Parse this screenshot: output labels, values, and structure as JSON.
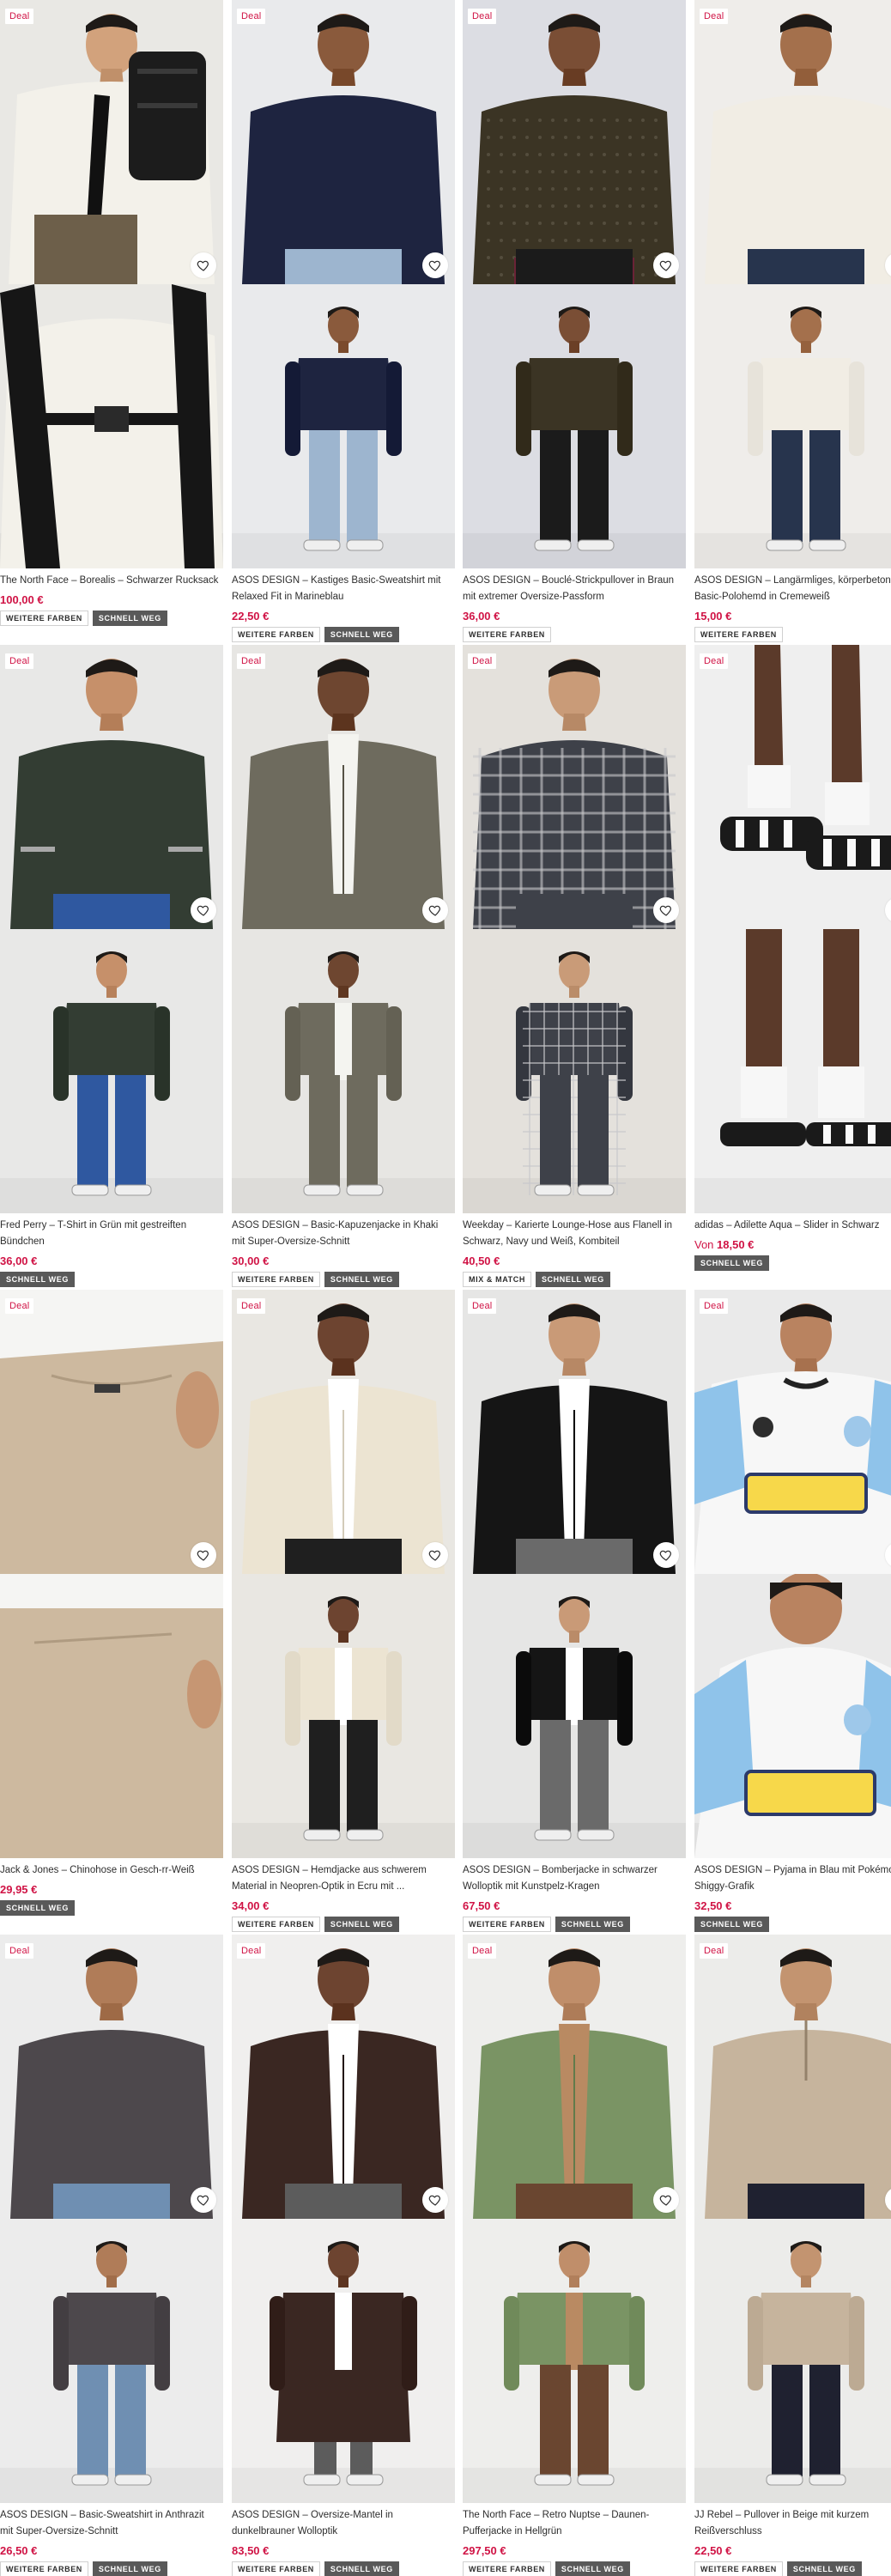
{
  "deal_label": "Deal",
  "products": [
    {
      "title": "The North Face – Borealis – Schwarzer Rucksack",
      "price": "100,00 €",
      "price_prefix": "",
      "deal": true,
      "tags": [
        "WEITERE FARBEN",
        "SCHNELL WEG"
      ],
      "garment": "backpack",
      "colors": {
        "bg": "#e9e8e4",
        "top": "#f3f1ea",
        "bottom": "#6d5f4a",
        "accent": "#1c1c1c",
        "skin": "#d2a27c"
      }
    },
    {
      "title": "ASOS DESIGN – Kastiges Basic-Sweatshirt mit Relaxed Fit in Marineblau",
      "price": "22,50 €",
      "price_prefix": "",
      "deal": true,
      "tags": [
        "WEITERE FARBEN",
        "SCHNELL WEG"
      ],
      "garment": "sweatshirt",
      "colors": {
        "bg": "#e9eaec",
        "top": "#1e2440",
        "bottom": "#9db5cf",
        "accent": "#1e2440",
        "skin": "#8a5a3c"
      }
    },
    {
      "title": "ASOS DESIGN – Bouclé-Strickpullover in Braun mit extremer Oversize-Passform",
      "price": "36,00 €",
      "price_prefix": "",
      "deal": true,
      "tags": [
        "WEITERE FARBEN"
      ],
      "garment": "knit",
      "colors": {
        "bg": "#dcdde3",
        "top": "#3b3424",
        "bottom": "#1b1b1b",
        "accent": "#6b2336",
        "skin": "#7a4e35"
      }
    },
    {
      "title": "ASOS DESIGN – Langärmliges, körperbetontes Basic-Polohemd in Cremeweiß",
      "price": "15,00 €",
      "price_prefix": "",
      "deal": true,
      "tags": [
        "WEITERE FARBEN"
      ],
      "garment": "polo",
      "colors": {
        "bg": "#efedea",
        "top": "#f1ede4",
        "bottom": "#27344d",
        "accent": "#27344d",
        "skin": "#a4704c"
      }
    },
    {
      "title": "Fred Perry – T-Shirt in Grün mit gestreiften Bündchen",
      "price": "36,00 €",
      "price_prefix": "",
      "deal": true,
      "tags": [
        "SCHNELL WEG"
      ],
      "garment": "tshirt",
      "colors": {
        "bg": "#e8e8e7",
        "top": "#333d33",
        "bottom": "#2f58a0",
        "accent": "#a8a8a8",
        "skin": "#c6906a"
      }
    },
    {
      "title": "ASOS DESIGN – Basic-Kapuzenjacke in Khaki mit Super-Oversize-Schnitt",
      "price": "30,00 €",
      "price_prefix": "",
      "deal": true,
      "tags": [
        "WEITERE FARBEN",
        "SCHNELL WEG"
      ],
      "garment": "hoodie",
      "colors": {
        "bg": "#e7e6e3",
        "top": "#6e6b5e",
        "bottom": "#6e6b5e",
        "accent": "#f4f4f0",
        "skin": "#6e4630"
      }
    },
    {
      "title": "Weekday – Karierte Lounge-Hose aus Flanell in Schwarz, Navy und Weiß, Kombiteil",
      "price": "40,50 €",
      "price_prefix": "",
      "deal": true,
      "tags": [
        "MIX & MATCH",
        "SCHNELL WEG"
      ],
      "garment": "check",
      "colors": {
        "bg": "#e4e1dc",
        "top": "#3e4149",
        "bottom": "#3e4149",
        "accent": "#c9c9cc",
        "skin": "#c99b78"
      }
    },
    {
      "title": "adidas – Adilette Aqua – Slider in Schwarz",
      "price": "18,50 €",
      "price_prefix": "Von",
      "deal": true,
      "tags": [
        "SCHNELL WEG"
      ],
      "garment": "slides",
      "colors": {
        "bg": "#efefef",
        "top": "#5b3a2a",
        "bottom": "#1a1a1a",
        "accent": "#f7f7f7",
        "skin": "#5b3a2a"
      }
    },
    {
      "title": "Jack & Jones – Chinohose in Gesch-rr-Weiß",
      "price": "29,95 €",
      "price_prefix": "",
      "deal": true,
      "tags": [
        "SCHNELL WEG"
      ],
      "garment": "chino",
      "colors": {
        "bg": "#eeeeec",
        "top": "#3b2f29",
        "bottom": "#cdb99f",
        "accent": "#f5f5f3",
        "skin": "#c69673"
      }
    },
    {
      "title": "ASOS DESIGN – Hemdjacke aus schwerem Material in Neopren-Optik in Ecru mit ...",
      "price": "34,00 €",
      "price_prefix": "",
      "deal": true,
      "tags": [
        "WEITERE FARBEN",
        "SCHNELL WEG"
      ],
      "garment": "shacket",
      "colors": {
        "bg": "#e9e7e2",
        "top": "#ece4d2",
        "bottom": "#1f1f1f",
        "accent": "#ffffff",
        "skin": "#6d4430"
      }
    },
    {
      "title": "ASOS DESIGN – Bomberjacke in schwarzer Wolloptik mit Kunstpelz-Kragen",
      "price": "67,50 €",
      "price_prefix": "",
      "deal": true,
      "tags": [
        "WEITERE FARBEN",
        "SCHNELL WEG"
      ],
      "garment": "bomber",
      "colors": {
        "bg": "#e6e6e5",
        "top": "#151515",
        "bottom": "#6a6a6a",
        "accent": "#ffffff",
        "skin": "#c99a77"
      }
    },
    {
      "title": "ASOS DESIGN – Pyjama in Blau mit Pokémon-Shiggy-Grafik",
      "price": "32,50 €",
      "price_prefix": "",
      "deal": true,
      "tags": [
        "SCHNELL WEG"
      ],
      "garment": "pokemon",
      "colors": {
        "bg": "#eaeaea",
        "top": "#f7f7f7",
        "bottom": "#1a1a1a",
        "accent": "#8fc3ea",
        "skin": "#b98360"
      }
    },
    {
      "title": "ASOS DESIGN – Basic-Sweatshirt in Anthrazit mit Super-Oversize-Schnitt",
      "price": "26,50 €",
      "price_prefix": "",
      "deal": true,
      "tags": [
        "WEITERE FARBEN",
        "SCHNELL WEG"
      ],
      "garment": "sweatshirt",
      "colors": {
        "bg": "#ececec",
        "top": "#4d484c",
        "bottom": "#6f8fb2",
        "accent": "#f4f4f4",
        "skin": "#b07c58"
      }
    },
    {
      "title": "ASOS DESIGN – Oversize-Mantel in dunkelbrauner Wolloptik",
      "price": "83,50 €",
      "price_prefix": "",
      "deal": true,
      "tags": [
        "WEITERE FARBEN",
        "SCHNELL WEG"
      ],
      "garment": "coat",
      "colors": {
        "bg": "#f0efee",
        "top": "#3a2722",
        "bottom": "#5c5c5c",
        "accent": "#ffffff",
        "skin": "#6d4430"
      }
    },
    {
      "title": "The North Face – Retro Nuptse – Daunen-Pufferjacke in Hellgrün",
      "price": "297,50 €",
      "price_prefix": "",
      "deal": true,
      "tags": [
        "WEITERE FARBEN",
        "SCHNELL WEG"
      ],
      "garment": "puffer",
      "colors": {
        "bg": "#eeeeec",
        "top": "#7a9464",
        "bottom": "#6a4630",
        "accent": "#b98a62",
        "skin": "#c08e6a"
      }
    },
    {
      "title": "JJ Rebel – Pullover in Beige mit kurzem Reißverschluss",
      "price": "22,50 €",
      "price_prefix": "",
      "deal": true,
      "tags": [
        "WEITERE FARBEN",
        "SCHNELL WEG"
      ],
      "garment": "zip",
      "colors": {
        "bg": "#ececea",
        "top": "#c6b49d",
        "bottom": "#1f2130",
        "accent": "#f3f1ec",
        "skin": "#c39470"
      }
    }
  ]
}
